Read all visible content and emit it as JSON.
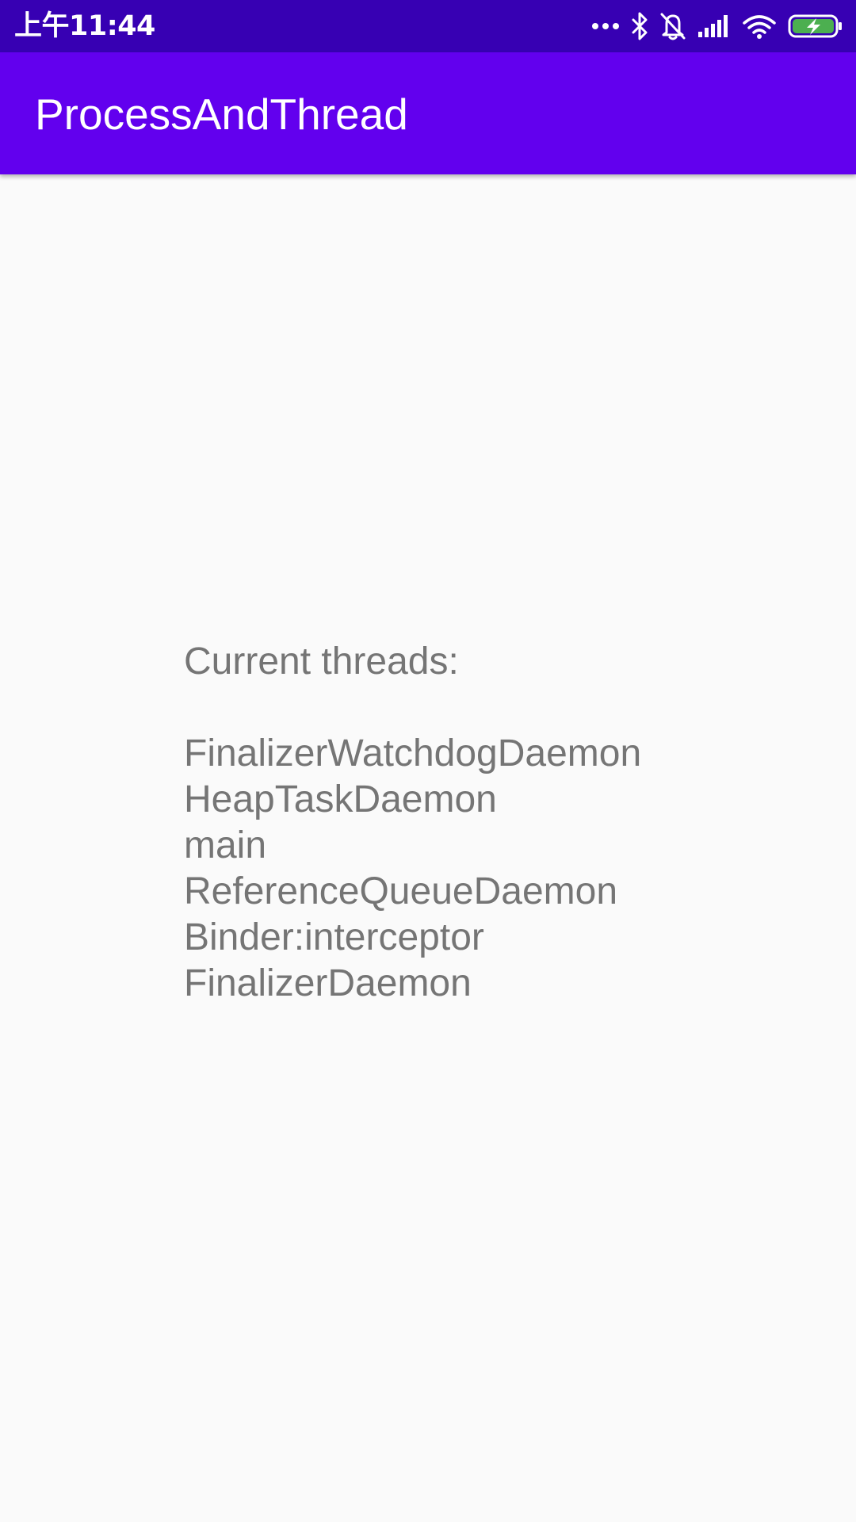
{
  "status_bar": {
    "time": "上午11:44",
    "icons": [
      "more-dots-icon",
      "bluetooth-icon",
      "bell-off-icon",
      "signal-icon",
      "wifi-icon",
      "battery-charging-icon"
    ],
    "colors": {
      "background": "#3700b3",
      "battery": "#4caf50"
    }
  },
  "app_bar": {
    "title": "ProcessAndThread",
    "color": "#6200ee"
  },
  "content": {
    "heading": "Current threads:",
    "threads": [
      "FinalizerWatchdogDaemon",
      "HeapTaskDaemon",
      "main",
      "ReferenceQueueDaemon",
      "Binder:interceptor",
      "FinalizerDaemon"
    ],
    "text_color": "#757575"
  }
}
